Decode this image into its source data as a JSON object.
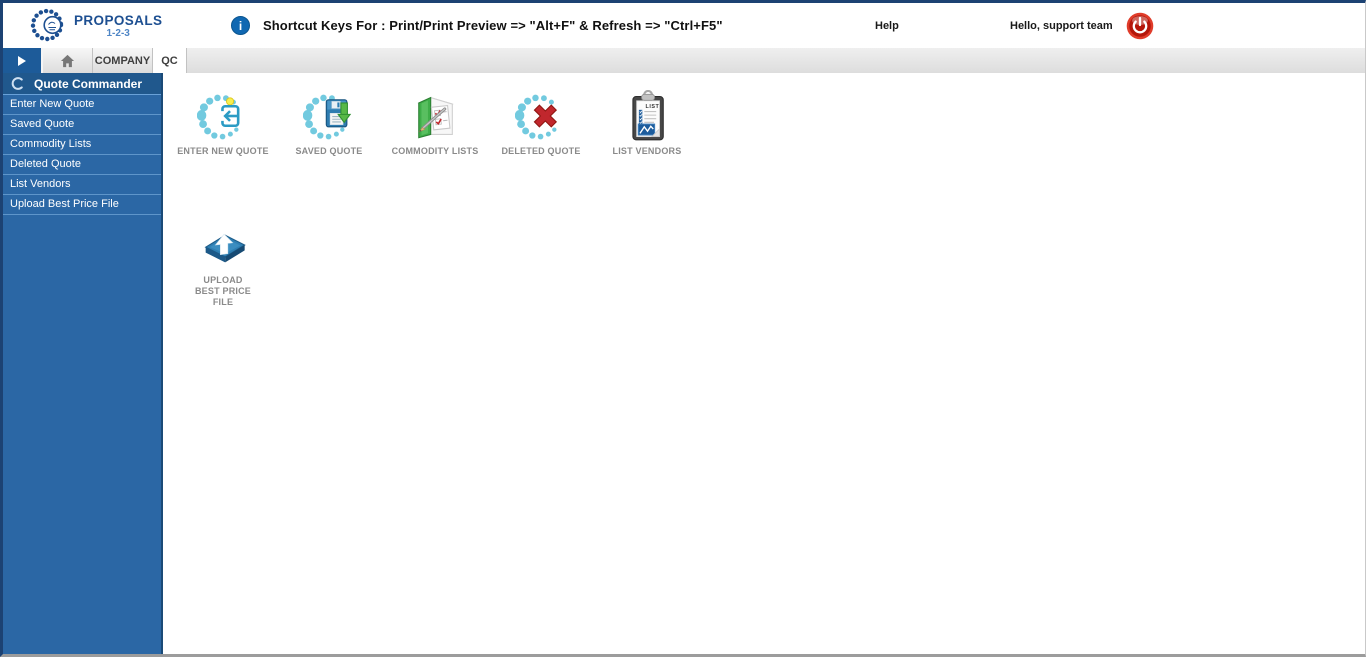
{
  "brand": {
    "name": "PROPOSALS",
    "tagline": "1-2-3"
  },
  "header": {
    "shortcut_notice": "Shortcut Keys For : Print/Print Preview => \"Alt+F\" & Refresh => \"Ctrl+F5\"",
    "help_label": "Help",
    "greeting": "Hello, support team"
  },
  "tab_bar": {
    "company_label": "COMPANY",
    "qc_label": "QC",
    "active_tab": "QC"
  },
  "sidebar": {
    "title": "Quote Commander",
    "items": [
      "Enter New Quote",
      "Saved Quote",
      "Commodity Lists",
      "Deleted Quote",
      "List Vendors",
      "Upload Best Price File"
    ]
  },
  "main": {
    "shortcuts": [
      {
        "label": "ENTER NEW QUOTE",
        "icon": "enter-new-quote-icon"
      },
      {
        "label": "SAVED QUOTE",
        "icon": "saved-quote-icon"
      },
      {
        "label": "COMMODITY LISTS",
        "icon": "commodity-lists-icon"
      },
      {
        "label": "DELETED QUOTE",
        "icon": "deleted-quote-icon"
      },
      {
        "label": "LIST VENDORS",
        "icon": "list-vendors-icon"
      },
      {
        "label": "UPLOAD BEST PRICE FILE",
        "icon": "upload-best-price-file-icon"
      }
    ]
  },
  "icon_names": [
    "proposals-logo-icon",
    "info-icon",
    "logout-power-icon",
    "nav-arrow-icon",
    "home-icon",
    "collapse-crescent-icon"
  ],
  "colors": {
    "brand_blue": "#1d4f91",
    "tab_active_blue": "#1d5b99",
    "sidebar_blue": "#2b67a5",
    "sidebar_header_blue": "#20588d",
    "info_blue": "#1068b2",
    "logout_red": "#b5170a",
    "dotted_circle_cyan": "#72cadf",
    "tile_label_gray": "#8a8a8a"
  }
}
